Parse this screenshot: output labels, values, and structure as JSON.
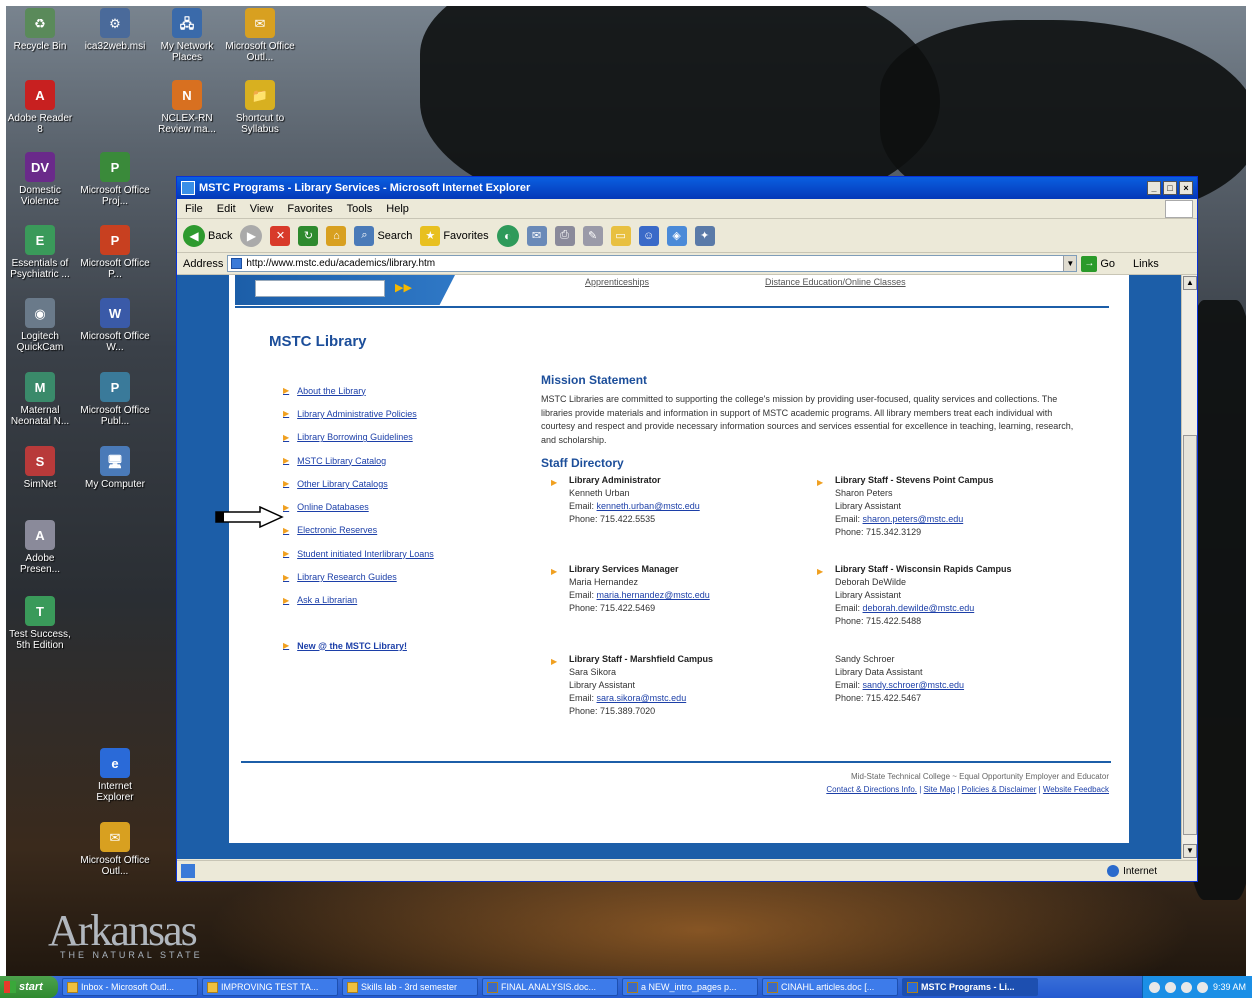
{
  "desktop": {
    "icons": [
      {
        "label": "Recycle Bin",
        "glyph": "♻",
        "color": "#5a8a5a"
      },
      {
        "label": "ica32web.msi",
        "glyph": "⚙",
        "color": "#4a6a9a"
      },
      {
        "label": "My Network Places",
        "glyph": "🖧",
        "color": "#3a6aaa"
      },
      {
        "label": "Microsoft Office Outl...",
        "glyph": "✉",
        "color": "#d8a020"
      },
      {
        "label": "Adobe Reader 8",
        "glyph": "A",
        "color": "#c82020"
      },
      {
        "label": "NCLEX-RN Review ma...",
        "glyph": "N",
        "color": "#d87020"
      },
      {
        "label": "Shortcut to Syllabus",
        "glyph": "📁",
        "color": "#d8b020"
      },
      {
        "label": "Domestic Violence",
        "glyph": "DV",
        "color": "#6a2a8a"
      },
      {
        "label": "Microsoft Office Proj...",
        "glyph": "P",
        "color": "#3a8a3a"
      },
      {
        "label": "Essentials of Psychiatric ...",
        "glyph": "E",
        "color": "#3a9a5a"
      },
      {
        "label": "Microsoft Office P...",
        "glyph": "P",
        "color": "#c84020"
      },
      {
        "label": "Logitech QuickCam",
        "glyph": "◉",
        "color": "#6a7a8a"
      },
      {
        "label": "Microsoft Office W...",
        "glyph": "W",
        "color": "#3a5aa8"
      },
      {
        "label": "Maternal Neonatal N...",
        "glyph": "M",
        "color": "#3a8a6a"
      },
      {
        "label": "Microsoft Office Publ...",
        "glyph": "P",
        "color": "#3a7a9a"
      },
      {
        "label": "SimNet",
        "glyph": "S",
        "color": "#b83a3a"
      },
      {
        "label": "My Computer",
        "glyph": "🖥",
        "color": "#4a7ab8"
      },
      {
        "label": "Adobe Presen...",
        "glyph": "A",
        "color": "#8a8a9a"
      },
      {
        "label": "Test Success, 5th Edition",
        "glyph": "T",
        "color": "#3a9a5a"
      },
      {
        "label": "Internet Explorer",
        "glyph": "e",
        "color": "#2a6ad8"
      },
      {
        "label": "Microsoft Office Outl...",
        "glyph": "✉",
        "color": "#d8a020"
      }
    ],
    "wallpaper_text": "Arkansas",
    "wallpaper_subtext": "THE NATURAL STATE"
  },
  "ie": {
    "title": "MSTC Programs - Library Services - Microsoft Internet Explorer",
    "window_buttons": [
      "_",
      "□",
      "×"
    ],
    "menu": [
      "File",
      "Edit",
      "View",
      "Favorites",
      "Tools",
      "Help"
    ],
    "toolbar": {
      "back": "Back",
      "search": "Search",
      "favorites": "Favorites"
    },
    "address_label": "Address",
    "address_url": "http://www.mstc.edu/academics/library.htm",
    "go_label": "Go",
    "links_label": "Links",
    "status_zone": "Internet"
  },
  "page": {
    "nav_links": [
      "Apprenticeships",
      "Distance Education/Online Classes"
    ],
    "title": "MSTC Library",
    "sidebar": [
      "About the Library",
      "Library Administrative Policies",
      "Library Borrowing Guidelines",
      "MSTC Library Catalog",
      "Other Library Catalogs",
      "Online Databases",
      "Electronic Reserves",
      "Student initiated Interlibrary Loans",
      "Library Research Guides",
      "Ask a Librarian"
    ],
    "sidebar_extra": "New @ the MSTC Library!",
    "mission_heading": "Mission Statement",
    "mission_text": "MSTC Libraries are committed to supporting the college's mission by providing user-focused, quality services and collections. The libraries provide materials and information in support of MSTC academic programs. All library members treat each individual with courtesy and respect and provide necessary information sources and services essential for excellence in teaching, learning, research, and scholarship.",
    "staff_heading": "Staff Directory",
    "staff": [
      {
        "role": "Library Administrator",
        "name": "Kenneth Urban",
        "title": "",
        "email": "kenneth.urban@mstc.edu",
        "phone": "715.422.5535"
      },
      {
        "role": "Library Staff - Stevens Point Campus",
        "name": "Sharon Peters",
        "title": "Library Assistant",
        "email": "sharon.peters@mstc.edu",
        "phone": "715.342.3129"
      },
      {
        "role": "Library Services Manager",
        "name": "Maria Hernandez",
        "title": "",
        "email": "maria.hernandez@mstc.edu",
        "phone": "715.422.5469"
      },
      {
        "role": "Library Staff - Wisconsin Rapids Campus",
        "name": "Deborah DeWilde",
        "title": "Library Assistant",
        "email": "deborah.dewilde@mstc.edu",
        "phone": "715.422.5488"
      },
      {
        "role": "Library Staff - Marshfield Campus",
        "name": "Sara Sikora",
        "title": "Library Assistant",
        "email": "sara.sikora@mstc.edu",
        "phone": "715.389.7020"
      },
      {
        "role": "",
        "name": "Sandy Schroer",
        "title": "Library Data Assistant",
        "email": "sandy.schroer@mstc.edu",
        "phone": "715.422.5467"
      }
    ],
    "email_label": "Email:",
    "phone_label": "Phone:",
    "footer_line": "Mid-State Technical College ~ Equal Opportunity Employer and Educator",
    "footer_links": [
      "Contact & Directions Info.",
      "Site Map",
      "Policies & Disclaimer",
      "Website Feedback"
    ]
  },
  "taskbar": {
    "start": "start",
    "tasks": [
      "Inbox - Microsoft Outl...",
      "IMPROVING TEST TA...",
      "Skills lab - 3rd semester",
      "FINAL ANALYSIS.doc...",
      "a NEW_intro_pages p...",
      "CINAHL articles.doc [...",
      "MSTC Programs - Li..."
    ],
    "clock": "9:39 AM"
  }
}
